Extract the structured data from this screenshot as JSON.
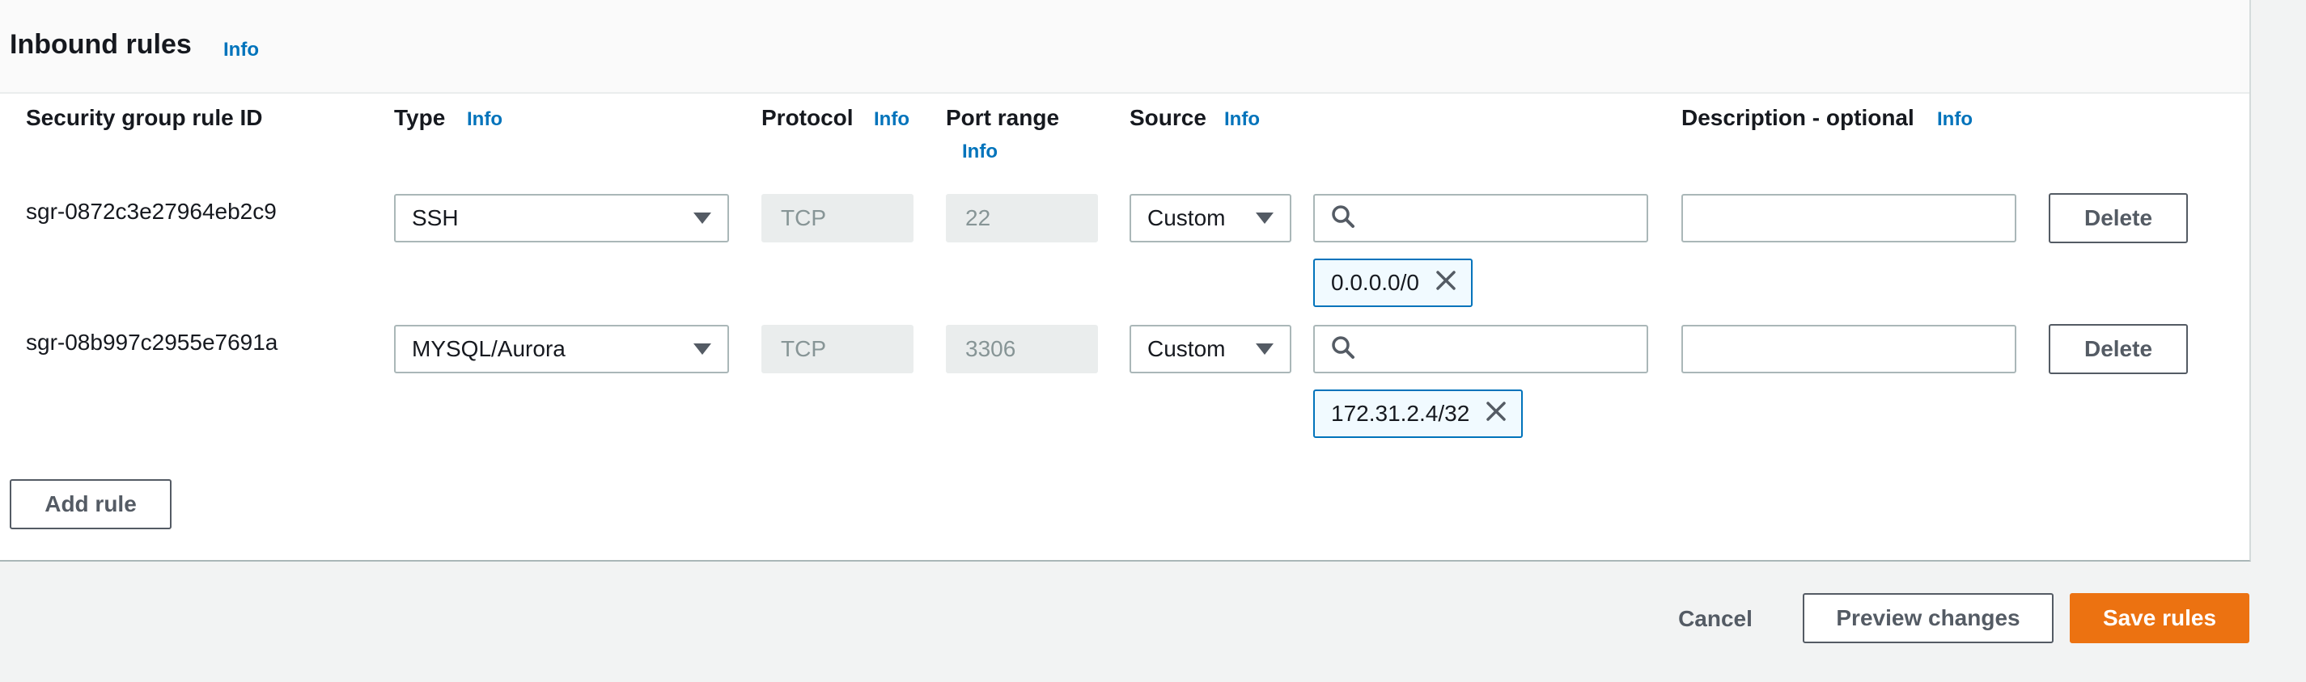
{
  "panel": {
    "title": "Inbound rules",
    "info": "Info"
  },
  "columns": {
    "rule_id": "Security group rule ID",
    "type": "Type",
    "protocol": "Protocol",
    "port_range": "Port range",
    "source": "Source",
    "description": "Description - optional",
    "info": "Info"
  },
  "rules": [
    {
      "id": "sgr-0872c3e27964eb2c9",
      "type": "SSH",
      "protocol": "TCP",
      "port_range": "22",
      "source_mode": "Custom",
      "search_value": "",
      "cidr": "0.0.0.0/0",
      "description": "",
      "delete_label": "Delete"
    },
    {
      "id": "sgr-08b997c2955e7691a",
      "type": "MYSQL/Aurora",
      "protocol": "TCP",
      "port_range": "3306",
      "source_mode": "Custom",
      "search_value": "",
      "cidr": "172.31.2.4/32",
      "description": "",
      "delete_label": "Delete"
    }
  ],
  "add_rule_label": "Add rule",
  "footer": {
    "cancel_label": "Cancel",
    "preview_label": "Preview changes",
    "save_label": "Save rules"
  },
  "icons": {
    "search": "search-icon",
    "dropdown": "caret-down-icon",
    "remove": "close-icon"
  },
  "colors": {
    "link": "#0073bb",
    "primary": "#ec7211",
    "token_border": "#0073bb",
    "token_bg": "#f1faff"
  }
}
